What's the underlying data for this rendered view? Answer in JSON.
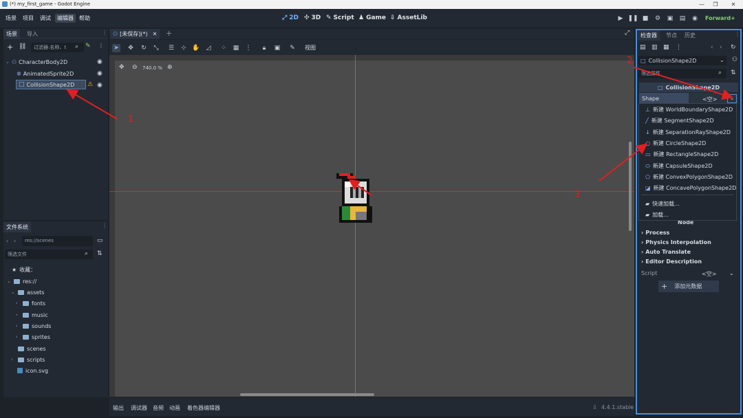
{
  "window": {
    "title": "(*) my_first_game - Godot Engine"
  },
  "menus": [
    "场景",
    "项目",
    "调试",
    "编辑器",
    "帮助"
  ],
  "modes": {
    "m2d": "2D",
    "m3d": "3D",
    "script": "Script",
    "game": "Game",
    "assetlib": "AssetLib"
  },
  "renderer": "Forward+",
  "scene_dock": {
    "tab_scene": "场景",
    "tab_import": "导入",
    "filter_placeholder": "过滤器:名称、t",
    "nodes": [
      {
        "name": "CharacterBody2D"
      },
      {
        "name": "AnimatedSprite2D"
      },
      {
        "name": "CollisionShape2D"
      }
    ]
  },
  "fs_dock": {
    "tab": "文件系统",
    "path": "res://scenes",
    "filter_placeholder": "筛选文件",
    "favorites": "收藏：",
    "root": "res://",
    "items": [
      {
        "name": "assets"
      },
      {
        "name": "fonts"
      },
      {
        "name": "music"
      },
      {
        "name": "sounds"
      },
      {
        "name": "sprites"
      },
      {
        "name": "scenes"
      },
      {
        "name": "scripts"
      },
      {
        "name": "icon.svg"
      }
    ]
  },
  "editor": {
    "tab": "[未保存](*)",
    "zoom": "740.0 %",
    "view_menu": "视图"
  },
  "bottom": {
    "output": "输出",
    "debugger": "调试器",
    "audio": "音频",
    "animation": "动画",
    "shader": "着色器编辑器",
    "version": "4.4.1.stable"
  },
  "inspector": {
    "tab_inspector": "检查器",
    "tab_node": "节点",
    "tab_history": "历史",
    "object": "CollisionShape2D",
    "filter_placeholder": "筛选属性",
    "section_title": "CollisionShape2D",
    "shape_label": "Shape",
    "shape_value": "<空>",
    "dropdown": {
      "items": [
        "新建 WorldBoundaryShape2D",
        "新建 SegmentShape2D",
        "新建 SeparationRayShape2D",
        "新建 CircleShape2D",
        "新建 RectangleShape2D",
        "新建 CapsuleShape2D",
        "新建 ConvexPolygonShape2D",
        "新建 ConcavePolygonShape2D"
      ],
      "quick_load": "快速加载...",
      "load": "加载..."
    },
    "node_section": "Node",
    "groups": [
      "Process",
      "Physics Interpolation",
      "Auto Translate",
      "Editor Description"
    ],
    "script_label": "Script",
    "script_value": "<空>",
    "add_meta": "添加元数据"
  },
  "annotations": {
    "a1": "1",
    "a2": "2",
    "a3": "3"
  },
  "colors": {
    "accent": "#478cbf",
    "highlight_box": "#4a90d9",
    "arrow": "#e02020",
    "axis_x": "#c04050",
    "axis_y": "#7fae3a"
  }
}
